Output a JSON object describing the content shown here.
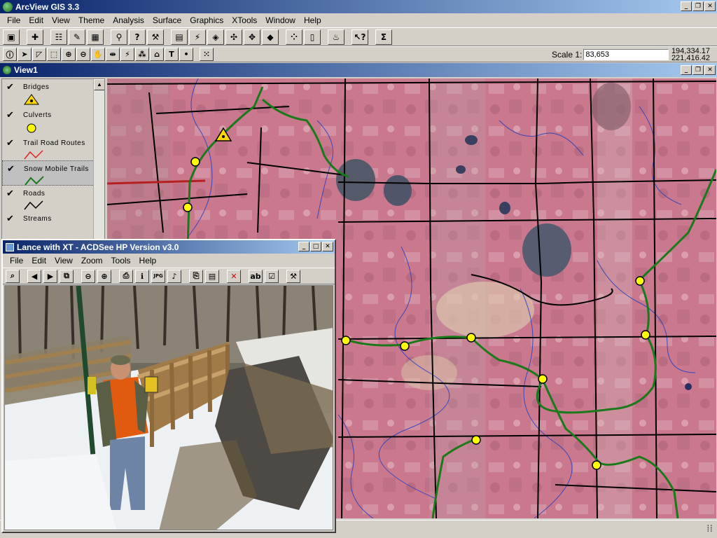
{
  "app": {
    "title": "ArcView GIS 3.3"
  },
  "menu": [
    "File",
    "Edit",
    "View",
    "Theme",
    "Analysis",
    "Surface",
    "Graphics",
    "XTools",
    "Window",
    "Help"
  ],
  "toolbar1": [
    "save-icon",
    "add-theme-icon",
    "theme-properties-icon",
    "edit-legend-icon",
    "open-table-icon",
    "find-icon",
    "query-builder-icon",
    "locate-address-icon",
    "layout-icon",
    "hot-link-icon",
    "select-features-icon",
    "zoom-extent-icon",
    "zoom-active-icon",
    "zoom-selected-icon",
    "zoom-in-fixed-icon",
    "zoom-out-fixed-icon",
    "zoom-previous-icon",
    "select-none-icon",
    "clear-selected-icon",
    "help-icon",
    "summarize-icon"
  ],
  "toolbar2": [
    "identify-icon",
    "pointer-icon",
    "vertex-edit-icon",
    "select-feature-icon",
    "zoom-in-icon",
    "zoom-out-icon",
    "pan-icon",
    "measure-icon",
    "hot-link-tool-icon",
    "area-of-interest-icon",
    "label-icon",
    "text-icon",
    "draw-point-icon",
    "snap-icon"
  ],
  "scale": {
    "label": "Scale 1:",
    "value": "83,653"
  },
  "coords": {
    "x": "194,334.17",
    "y": "221,416.42"
  },
  "view": {
    "title": "View1"
  },
  "legend": [
    {
      "label": "Bridges",
      "symbol": "triangle",
      "color": "#ffd700"
    },
    {
      "label": "Culverts",
      "symbol": "circle",
      "color": "#ffff00"
    },
    {
      "label": "Trail Road Routes",
      "symbol": "line",
      "color": "#e02020"
    },
    {
      "label": "Snow Mobile Trails",
      "symbol": "line",
      "color": "#1a7a1a"
    },
    {
      "label": "Roads",
      "symbol": "line",
      "color": "#000000"
    },
    {
      "label": "Streams",
      "symbol": "line",
      "color": "#1a3fbf"
    }
  ],
  "acdsee": {
    "title": "Lance with XT - ACDSee HP Version v3.0",
    "menu": [
      "File",
      "Edit",
      "View",
      "Zoom",
      "Tools",
      "Help"
    ],
    "toolbar": [
      "browse-icon",
      "previous-icon",
      "next-icon",
      "full-screen-icon",
      "zoom-out-icon",
      "zoom-in-icon",
      "print-icon",
      "image-info-icon",
      "jpeg-icon",
      "sound-icon",
      "copy-icon",
      "paste-icon",
      "delete-icon",
      "rename-icon",
      "properties-icon",
      "tools-icon"
    ]
  },
  "colors": {
    "title_start": "#0a246a",
    "title_end": "#a6caf0",
    "trail": "#1a7a1a",
    "culvert": "#ffff00",
    "map_bg": "#c9788e"
  }
}
